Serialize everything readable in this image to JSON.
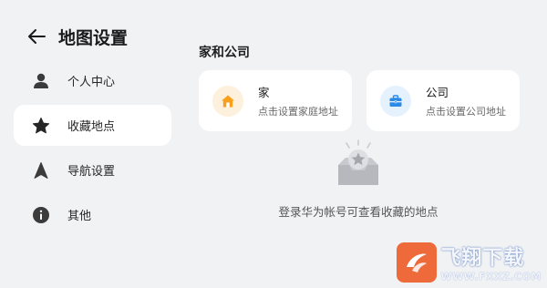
{
  "header": {
    "title": "地图设置",
    "back_icon": "arrow-left-icon"
  },
  "sidebar": {
    "items": [
      {
        "label": "个人中心",
        "icon": "person-icon",
        "active": false
      },
      {
        "label": "收藏地点",
        "icon": "star-icon",
        "active": true
      },
      {
        "label": "导航设置",
        "icon": "navigation-arrow-icon",
        "active": false
      },
      {
        "label": "其他",
        "icon": "info-icon",
        "active": false
      }
    ]
  },
  "main": {
    "section_title": "家和公司",
    "cards": [
      {
        "title": "家",
        "subtitle": "点击设置家庭地址",
        "icon": "home-icon",
        "accent": "#f7a01d"
      },
      {
        "title": "公司",
        "subtitle": "点击设置公司地址",
        "icon": "briefcase-icon",
        "accent": "#2a8ae6"
      }
    ],
    "empty_state": {
      "icon": "inbox-star-icon",
      "text": "登录华为帐号可查看收藏的地点"
    }
  },
  "watermark": {
    "title": "飞翔下载",
    "url": "WWW.FXXZ.COM"
  },
  "colors": {
    "background": "#f1f2f4",
    "card": "#ffffff",
    "text_primary": "#1a1a1a",
    "text_secondary": "#6a6a6a"
  }
}
